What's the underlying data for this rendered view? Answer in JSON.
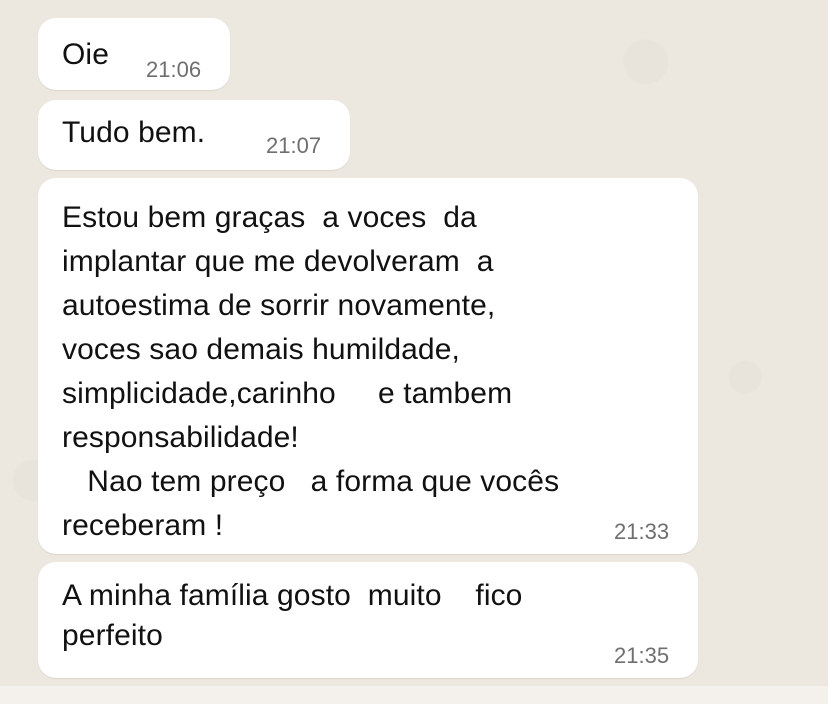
{
  "messages": [
    {
      "text": "Oie",
      "time": "21:06"
    },
    {
      "text": "Tudo bem.",
      "time": "21:07"
    },
    {
      "text": "Estou bem graças  a voces  da\nimplantar que me devolveram  a\nautoestima de sorrir novamente,\nvoces sao demais humildade,\nsimplicidade,carinho     e tambem\nresponsabilidade!\n   Nao tem preço   a forma que vocês\nreceberam !",
      "time": "21:33"
    },
    {
      "text": "A minha família gosto  muito    fico\nperfeito",
      "time": "21:35"
    }
  ],
  "colors": {
    "background": "#ede8df",
    "bubble": "#ffffff",
    "timestamp": "#6f6f6f"
  }
}
